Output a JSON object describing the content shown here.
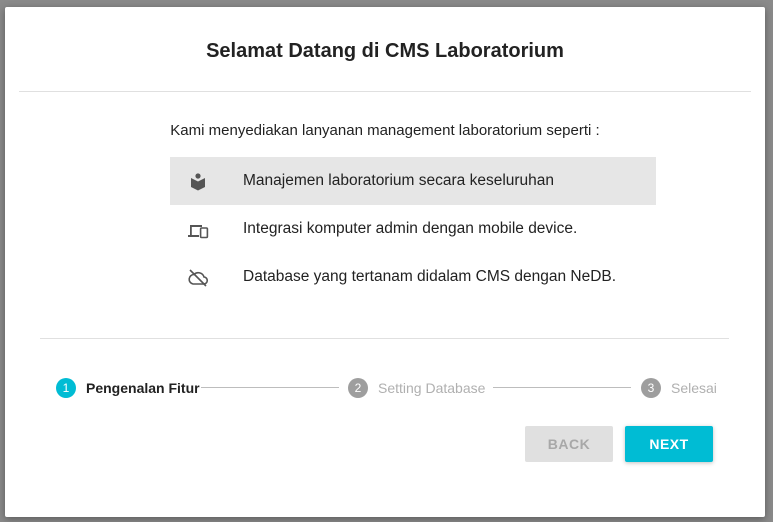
{
  "dialog": {
    "title": "Selamat Datang di CMS Laboratorium",
    "intro": "Kami menyediakan lanyanan management laboratorium seperti :",
    "features": [
      {
        "icon": "book-reader-icon",
        "label": "Manajemen laboratorium secara keseluruhan"
      },
      {
        "icon": "devices-icon",
        "label": "Integrasi komputer admin dengan mobile device."
      },
      {
        "icon": "cloud-off-icon",
        "label": "Database yang tertanam didalam CMS dengan NeDB."
      }
    ]
  },
  "stepper": {
    "steps": [
      {
        "number": "1",
        "label": "Pengenalan Fitur",
        "state": "active"
      },
      {
        "number": "2",
        "label": "Setting Database",
        "state": "inactive"
      },
      {
        "number": "3",
        "label": "Selesai",
        "state": "inactive"
      }
    ]
  },
  "buttons": {
    "back": "BACK",
    "next": "NEXT"
  },
  "colors": {
    "accent": "#00bcd4",
    "inactive_step": "#9e9e9e"
  }
}
